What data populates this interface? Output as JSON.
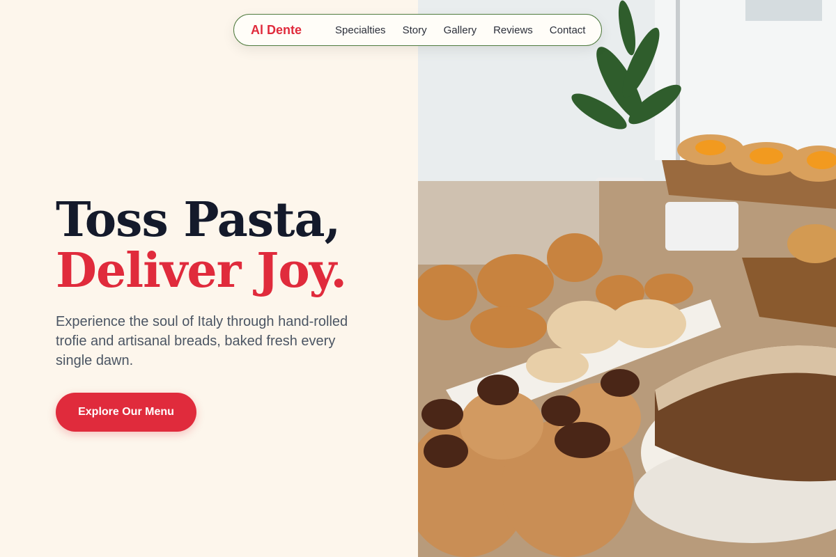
{
  "nav": {
    "brand": "Al Dente",
    "links": [
      "Specialties",
      "Story",
      "Gallery",
      "Reviews",
      "Contact"
    ]
  },
  "hero": {
    "headline_line1": "Toss Pasta,",
    "headline_line2": "Deliver Joy.",
    "subtitle": "Experience the soul of Italy through hand-rolled trofie and artisanal breads, baked fresh every single dawn.",
    "cta_label": "Explore Our Menu"
  },
  "colors": {
    "accent": "#e02b3c",
    "headline_dark": "#141a2b",
    "page_bg": "#fdf6ec",
    "nav_border": "#4f7a3d"
  }
}
